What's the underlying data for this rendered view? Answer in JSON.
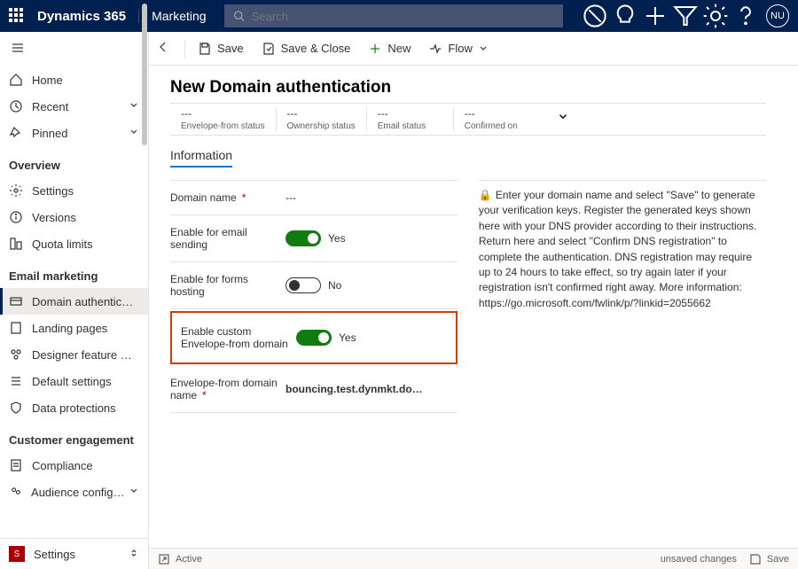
{
  "topbar": {
    "brand": "Dynamics 365",
    "module": "Marketing",
    "search_placeholder": "Search",
    "avatar": "NU"
  },
  "sidebar": {
    "top": [
      {
        "label": "Home"
      },
      {
        "label": "Recent"
      },
      {
        "label": "Pinned"
      }
    ],
    "sections": [
      {
        "heading": "Overview",
        "items": [
          {
            "label": "Settings"
          },
          {
            "label": "Versions"
          },
          {
            "label": "Quota limits"
          }
        ]
      },
      {
        "heading": "Email marketing",
        "items": [
          {
            "label": "Domain authentic…",
            "active": true
          },
          {
            "label": "Landing pages"
          },
          {
            "label": "Designer feature …"
          },
          {
            "label": "Default settings"
          },
          {
            "label": "Data protections"
          }
        ]
      },
      {
        "heading": "Customer engagement",
        "items": [
          {
            "label": "Compliance"
          },
          {
            "label": "Audience configur…"
          }
        ]
      }
    ],
    "area": {
      "initial": "S",
      "label": "Settings"
    }
  },
  "cmdbar": {
    "save": "Save",
    "save_close": "Save & Close",
    "new": "New",
    "flow": "Flow"
  },
  "page": {
    "title": "New Domain authentication",
    "status": [
      {
        "value": "---",
        "label": "Envelope-from status"
      },
      {
        "value": "---",
        "label": "Ownership status"
      },
      {
        "value": "---",
        "label": "Email status"
      },
      {
        "value": "---",
        "label": "Confirmed on"
      }
    ],
    "tab": "Information",
    "fields": {
      "domain_name": {
        "label": "Domain name",
        "value": "---"
      },
      "enable_email": {
        "label": "Enable for email sending",
        "on": true,
        "text": "Yes"
      },
      "enable_forms": {
        "label": "Enable for forms hosting",
        "on": false,
        "text": "No"
      },
      "enable_custom_envelope": {
        "label": "Enable custom Envelope-from domain",
        "on": true,
        "text": "Yes"
      },
      "envelope_domain": {
        "label": "Envelope-from domain name",
        "value": "bouncing.test.dynmkt.do…"
      }
    },
    "help": "Enter your domain name and select \"Save\" to generate your verification keys. Register the generated keys shown here with your DNS provider according to their instructions. Return here and select \"Confirm DNS registration\" to complete the authentication. DNS registration may require up to 24 hours to take effect, so try again later if your registration isn't confirmed right away. More information: https://go.microsoft.com/fwlink/p/?linkid=2055662"
  },
  "footer": {
    "status": "Active",
    "unsaved": "unsaved changes",
    "save": "Save"
  }
}
